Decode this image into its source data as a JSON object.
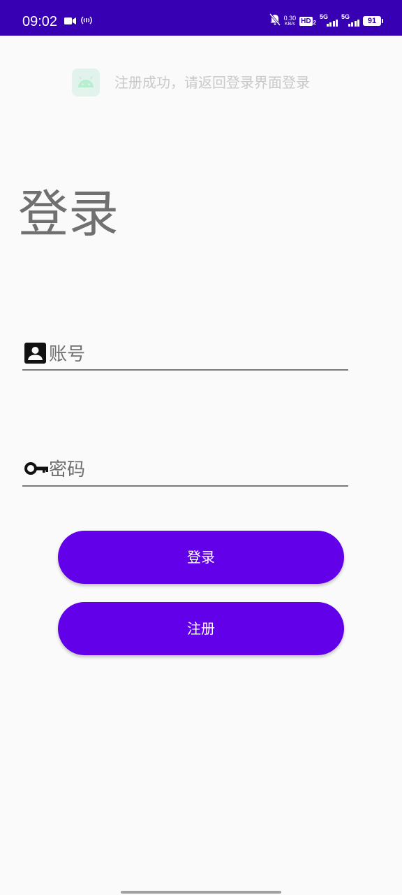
{
  "status_bar": {
    "time": "09:02",
    "network_speed_value": "0.30",
    "network_speed_unit": "KB/s",
    "hd_label": "HD",
    "hd_sub": "2",
    "signal_1_label": "5G",
    "signal_2_label": "5G",
    "battery_level": "91",
    "background_color": "#3700b3"
  },
  "toast": {
    "icon": "android-icon",
    "message": "注册成功，请返回登录界面登录"
  },
  "login": {
    "title": "登录",
    "account_placeholder": "账号",
    "account_icon": "account-box-icon",
    "password_placeholder": "密码",
    "password_icon": "key-icon",
    "login_button": "登录",
    "register_button": "注册",
    "accent_color": "#6200ea"
  }
}
